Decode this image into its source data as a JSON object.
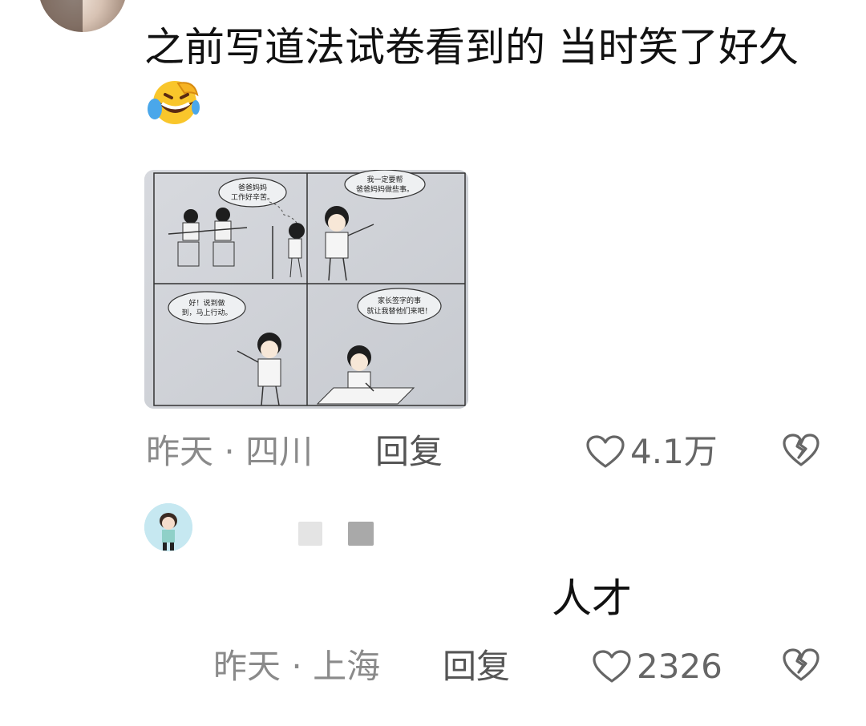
{
  "comment1": {
    "text": "之前写道法试卷看到的 当时笑了好久",
    "emoji": "laughing-crying-emoji",
    "comic_panels": [
      "爸爸妈妈工作好辛苦。",
      "我一定要帮爸爸妈妈做些事。",
      "好！说到做到，马上行动。",
      "家长签字的事就让我替他们来吧！"
    ],
    "time": "昨天",
    "location": "四川",
    "reply_label": "回复",
    "likes": "4.1万"
  },
  "comment2": {
    "text": "人才",
    "time": "昨天",
    "location": "上海",
    "reply_label": "回复",
    "likes": "2326"
  },
  "colors": {
    "meta_text": "#8a8a8a",
    "body_text": "#111111",
    "icon_gray": "#666666"
  }
}
